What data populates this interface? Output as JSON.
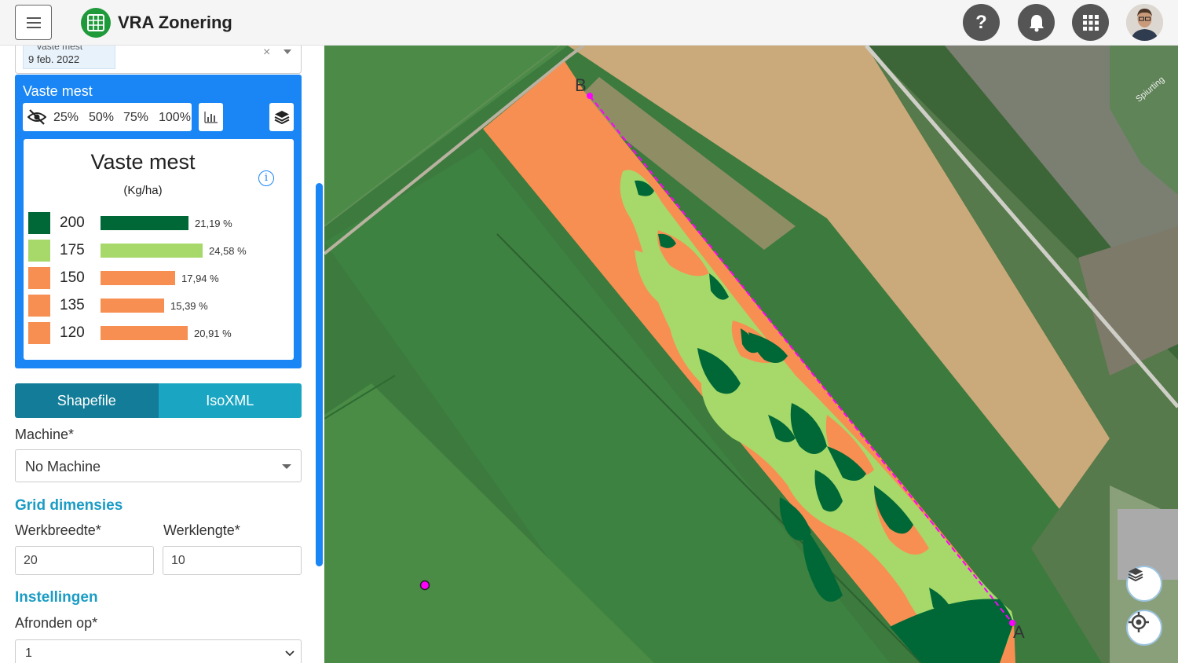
{
  "header": {
    "app_title": "VRA Zonering",
    "help_label": "?"
  },
  "sidebar": {
    "date_select": {
      "chip_label": "Vaste mest",
      "chip_date": "9 feb. 2022",
      "clear_label": "×"
    },
    "layer_panel": {
      "title": "Vaste mest",
      "opacity_options": [
        "25%",
        "50%",
        "75%",
        "100%"
      ]
    },
    "legend": {
      "title": "Vaste mest",
      "unit": "(Kg/ha)",
      "info_label": "i",
      "rows": [
        {
          "value": "200",
          "percent": "21,19 %",
          "share": 21.19,
          "color": "#006837"
        },
        {
          "value": "175",
          "percent": "24,58 %",
          "share": 24.58,
          "color": "#a6d96a"
        },
        {
          "value": "150",
          "percent": "17,94 %",
          "share": 17.94,
          "color": "#f88f52"
        },
        {
          "value": "135",
          "percent": "15,39 %",
          "share": 15.39,
          "color": "#f88f52"
        },
        {
          "value": "120",
          "percent": "20,91 %",
          "share": 20.91,
          "color": "#f88f52"
        }
      ]
    },
    "export_tabs": {
      "shapefile": "Shapefile",
      "isoxml": "IsoXML"
    },
    "machine": {
      "label": "Machine*",
      "value": "No Machine"
    },
    "grid": {
      "section_title": "Grid dimensies",
      "width_label": "Werkbreedte*",
      "width_value": "20",
      "length_label": "Werklengte*",
      "length_value": "10"
    },
    "settings": {
      "section_title": "Instellingen",
      "rounding_label": "Afronden op*",
      "rounding_value": "1"
    }
  },
  "map": {
    "point_a_label": "A",
    "point_b_label": "B",
    "place_label": "Spiurting",
    "colors": {
      "zone_200": "#006837",
      "zone_175": "#a6d96a",
      "zone_low": "#f88f52",
      "ab_line": "#ff00ff"
    }
  }
}
